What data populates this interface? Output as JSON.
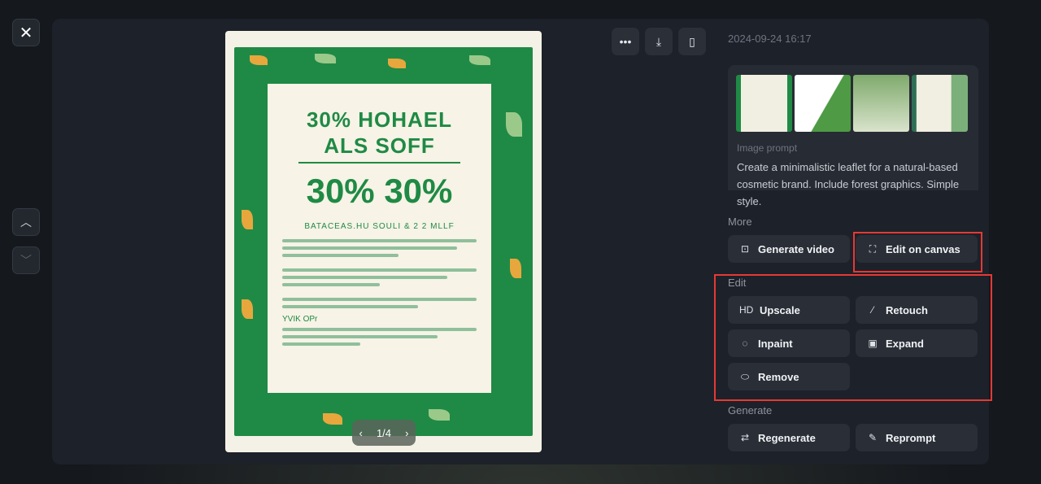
{
  "toolbar": {
    "close_icon": "close-icon",
    "up_icon": "chevron-up-icon",
    "down_icon": "chevron-down-icon",
    "more_icon": "more-horizontal-icon",
    "download_icon": "download-icon",
    "bookmark_icon": "bookmark-icon"
  },
  "image": {
    "lettering": {
      "headline1": "30% HOHAEL",
      "headline2": "ALS SOFF",
      "big": "30% 30%",
      "subline": "BATACEAS.HU SOULI & 2 2 MLLF",
      "section": "YVIK OPr"
    },
    "pager": "1/4"
  },
  "details": {
    "date": "2024-09-24 16:17",
    "prompt_label": "Image prompt",
    "prompt_text": "Create a minimalistic leaflet for a natural-based cosmetic brand. Include forest graphics. Simple style.",
    "thumbnail_count": 4
  },
  "sections": {
    "more": {
      "label": "More",
      "buttons": [
        {
          "label": "Generate video",
          "icon": "video-plus-icon"
        },
        {
          "label": "Edit on canvas",
          "icon": "canvas-icon"
        }
      ]
    },
    "edit": {
      "label": "Edit",
      "buttons": [
        {
          "label": "Upscale",
          "icon": "HD"
        },
        {
          "label": "Retouch",
          "icon": "magic-wand-icon"
        },
        {
          "label": "Inpaint",
          "icon": "brush-icon"
        },
        {
          "label": "Expand",
          "icon": "expand-icon"
        },
        {
          "label": "Remove",
          "icon": "eraser-icon"
        }
      ]
    },
    "generate": {
      "label": "Generate",
      "buttons": [
        {
          "label": "Regenerate",
          "icon": "repeat-icon"
        },
        {
          "label": "Reprompt",
          "icon": "pencil-icon"
        }
      ]
    }
  },
  "colors": {
    "highlight": "#e53935",
    "poster_green": "#1f8a45"
  }
}
